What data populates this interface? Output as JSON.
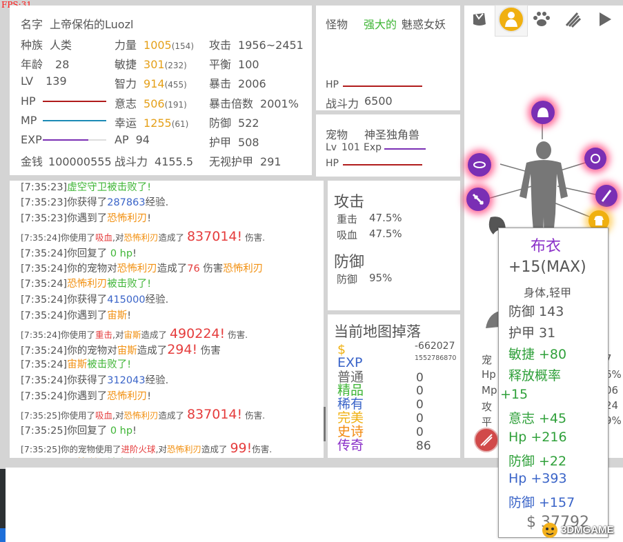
{
  "fps": "FPS:31",
  "player": {
    "stats": [
      {
        "label": "名字",
        "value": "上帝保佑的Luozl"
      },
      {
        "label": "种族",
        "value": "人类"
      },
      {
        "label": "年龄",
        "value": "28"
      },
      {
        "label": "LV",
        "value": "139"
      },
      {
        "label": "HP",
        "value": ""
      },
      {
        "label": "MP",
        "value": ""
      },
      {
        "label": "EXP",
        "value": ""
      },
      {
        "label": "金钱",
        "value": "100000555"
      }
    ],
    "attrs": [
      {
        "label": "力量",
        "value": "1005",
        "bonus": "(154)"
      },
      {
        "label": "敏捷",
        "value": "301",
        "bonus": "(232)"
      },
      {
        "label": "智力",
        "value": "914",
        "bonus": "(455)"
      },
      {
        "label": "意志",
        "value": "506",
        "bonus": "(191)"
      },
      {
        "label": "幸运",
        "value": "1255",
        "bonus": "(61)"
      },
      {
        "label": "AP",
        "value": "94",
        "bonus": ""
      },
      {
        "label": "战斗力",
        "value": "4155.5",
        "bonus": ""
      }
    ],
    "combat": [
      {
        "label": "攻击",
        "value": "1956~2451"
      },
      {
        "label": "平衡",
        "value": "100"
      },
      {
        "label": "暴击",
        "value": "2006"
      },
      {
        "label": "暴击倍数",
        "value": "2001%"
      },
      {
        "label": "防御",
        "value": "522"
      },
      {
        "label": "护甲",
        "value": "508"
      },
      {
        "label": "无视护甲",
        "value": "291"
      }
    ]
  },
  "monster": {
    "label": "怪物",
    "prefix": "强大的",
    "name": "魅惑女妖",
    "hp_label": "HP",
    "power_label": "战斗力",
    "power": "6500",
    "hp_fraction": 1.0
  },
  "pet": {
    "label": "宠物",
    "name": "神圣独角兽",
    "lv_label": "Lv",
    "lv": "101",
    "exp_label": "Exp",
    "hp_label": "HP"
  },
  "log": [
    {
      "t": "[7:35:23]",
      "parts": [
        {
          "c": "c-green",
          "s": "虚空守卫"
        },
        {
          "c": "c-green",
          "s": "被击败了!"
        }
      ],
      "small": false
    },
    {
      "t": "[7:35:23]",
      "parts": [
        {
          "c": "c-gray",
          "s": "你获得了"
        },
        {
          "c": "c-blue",
          "s": "287863"
        },
        {
          "c": "c-gray",
          "s": "经验."
        }
      ],
      "small": false
    },
    {
      "t": "[7:35:23]",
      "parts": [
        {
          "c": "c-gray",
          "s": "你遇到了"
        },
        {
          "c": "c-orange",
          "s": "恐怖利刃"
        },
        {
          "c": "c-gray",
          "s": "!"
        }
      ],
      "small": false
    },
    {
      "t": "[7:35:24]",
      "parts": [
        {
          "c": "c-gray",
          "s": "你使用了"
        },
        {
          "c": "c-red",
          "s": "吸血"
        },
        {
          "c": "c-gray",
          "s": ",对"
        },
        {
          "c": "c-orange",
          "s": "恐怖利刃"
        },
        {
          "c": "c-gray",
          "s": "造成了 "
        },
        {
          "c": "c-red big",
          "s": "837014!"
        },
        {
          "c": "c-gray",
          "s": " 伤害."
        }
      ],
      "small": true
    },
    {
      "t": "[7:35:24]",
      "parts": [
        {
          "c": "c-gray",
          "s": "你回复了 "
        },
        {
          "c": "c-green",
          "s": "0 hp"
        },
        {
          "c": "c-gray",
          "s": "!"
        }
      ],
      "small": false
    },
    {
      "t": "[7:35:24]",
      "parts": [
        {
          "c": "c-gray",
          "s": "你的宠物对"
        },
        {
          "c": "c-orange",
          "s": "恐怖利刃"
        },
        {
          "c": "c-gray",
          "s": "造成了"
        },
        {
          "c": "c-red",
          "s": "76"
        },
        {
          "c": "c-gray",
          "s": " 伤害"
        },
        {
          "c": "c-orange",
          "s": "恐怖利刃"
        }
      ],
      "small": false
    },
    {
      "t": "[7:35:24]",
      "parts": [
        {
          "c": "c-orange",
          "s": "恐怖利刃"
        },
        {
          "c": "c-green",
          "s": "被击败了!"
        }
      ],
      "small": false
    },
    {
      "t": "[7:35:24]",
      "parts": [
        {
          "c": "c-gray",
          "s": "你获得了"
        },
        {
          "c": "c-blue",
          "s": "415000"
        },
        {
          "c": "c-gray",
          "s": "经验."
        }
      ],
      "small": false
    },
    {
      "t": "[7:35:24]",
      "parts": [
        {
          "c": "c-gray",
          "s": "你遇到了"
        },
        {
          "c": "c-orange",
          "s": "宙斯"
        },
        {
          "c": "c-gray",
          "s": "!"
        }
      ],
      "small": false
    },
    {
      "t": "[7:35:24]",
      "parts": [
        {
          "c": "c-gray",
          "s": "你使用了"
        },
        {
          "c": "c-red",
          "s": "重击"
        },
        {
          "c": "c-gray",
          "s": ",对"
        },
        {
          "c": "c-orange",
          "s": "宙斯"
        },
        {
          "c": "c-gray",
          "s": "造成了 "
        },
        {
          "c": "c-red big",
          "s": "490224!"
        },
        {
          "c": "c-gray",
          "s": " 伤害."
        }
      ],
      "small": true
    },
    {
      "t": "[7:35:24]",
      "parts": [
        {
          "c": "c-gray",
          "s": "你的宠物对"
        },
        {
          "c": "c-orange",
          "s": "宙斯"
        },
        {
          "c": "c-gray",
          "s": "造成了"
        },
        {
          "c": "c-red big",
          "s": "294!"
        },
        {
          "c": "c-gray",
          "s": " 伤害"
        }
      ],
      "small": false
    },
    {
      "t": "[7:35:24]",
      "parts": [
        {
          "c": "c-orange",
          "s": "宙斯"
        },
        {
          "c": "c-green",
          "s": "被击败了!"
        }
      ],
      "small": false
    },
    {
      "t": "[7:35:24]",
      "parts": [
        {
          "c": "c-gray",
          "s": "你获得了"
        },
        {
          "c": "c-blue",
          "s": "312043"
        },
        {
          "c": "c-gray",
          "s": "经验."
        }
      ],
      "small": false
    },
    {
      "t": "[7:35:24]",
      "parts": [
        {
          "c": "c-gray",
          "s": "你遇到了"
        },
        {
          "c": "c-orange",
          "s": "恐怖利刃"
        },
        {
          "c": "c-gray",
          "s": "!"
        }
      ],
      "small": false
    },
    {
      "t": "[7:35:25]",
      "parts": [
        {
          "c": "c-gray",
          "s": "你使用了"
        },
        {
          "c": "c-red",
          "s": "吸血"
        },
        {
          "c": "c-gray",
          "s": ",对"
        },
        {
          "c": "c-orange",
          "s": "恐怖利刃"
        },
        {
          "c": "c-gray",
          "s": "造成了 "
        },
        {
          "c": "c-red big",
          "s": "837014!"
        },
        {
          "c": "c-gray",
          "s": " 伤害."
        }
      ],
      "small": true
    },
    {
      "t": "[7:35:25]",
      "parts": [
        {
          "c": "c-gray",
          "s": "你回复了 "
        },
        {
          "c": "c-green",
          "s": "0 hp"
        },
        {
          "c": "c-gray",
          "s": "!"
        }
      ],
      "small": false
    },
    {
      "t": "[7:35:25]",
      "parts": [
        {
          "c": "c-gray",
          "s": "你的宠物使用了"
        },
        {
          "c": "c-red",
          "s": "进阶火球"
        },
        {
          "c": "c-gray",
          "s": ",对"
        },
        {
          "c": "c-orange",
          "s": "恐怖利刃"
        },
        {
          "c": "c-gray",
          "s": "造成了 "
        },
        {
          "c": "c-red big",
          "s": "99!"
        },
        {
          "c": "c-gray",
          "s": "伤害."
        }
      ],
      "small": true
    },
    {
      "t": "[7:35:25]",
      "parts": [
        {
          "c": "c-orange",
          "s": "恐怖利刃"
        },
        {
          "c": "c-green",
          "s": "被击败了!"
        }
      ],
      "small": false
    }
  ],
  "skills": {
    "attack_title": "攻击",
    "attack": [
      {
        "label": "重击",
        "value": "47.5%"
      },
      {
        "label": "吸血",
        "value": "47.5%"
      }
    ],
    "defense_title": "防御",
    "defense": [
      {
        "label": "防御",
        "value": "95%"
      }
    ]
  },
  "drops": {
    "title": "当前地图掉落",
    "money_symbol": "$",
    "money": "-662027",
    "exp_label": "EXP",
    "exp": "1552786870",
    "items": [
      {
        "label": "普通",
        "value": "0",
        "color": "#666666"
      },
      {
        "label": "精品",
        "value": "0",
        "color": "#3fb536"
      },
      {
        "label": "稀有",
        "value": "0",
        "color": "#3a64c8"
      },
      {
        "label": "完美",
        "value": "0",
        "color": "#f0b010"
      },
      {
        "label": "史诗",
        "value": "0",
        "color": "#f28a10"
      },
      {
        "label": "传奇",
        "value": "86",
        "color": "#8a2fc8"
      }
    ]
  },
  "tabs": [
    {
      "name": "bag-icon",
      "active": false
    },
    {
      "name": "character-icon",
      "active": true
    },
    {
      "name": "paw-icon",
      "active": false
    },
    {
      "name": "claw-icon",
      "active": false
    },
    {
      "name": "play-icon",
      "active": false
    }
  ],
  "pet_partial": {
    "labels": [
      "宠",
      "Hp",
      "Mp",
      "攻",
      "平"
    ],
    "values": [
      "7",
      "6%",
      "06",
      "24",
      "9%"
    ]
  },
  "tooltip": {
    "name": "布衣",
    "level": "+15(MAX)",
    "type": "身体,轻甲",
    "base": [
      {
        "label": "防御",
        "value": "143"
      },
      {
        "label": "护甲",
        "value": "31"
      }
    ],
    "bonus_green": [
      {
        "label": "敏捷",
        "value": "+80"
      },
      {
        "label": "释放概率",
        "value": ""
      },
      {
        "label": "",
        "value": "+15"
      },
      {
        "label": "意志",
        "value": "+45"
      },
      {
        "label": "Hp",
        "value": "+216"
      },
      {
        "label": "防御",
        "value": "+22"
      }
    ],
    "bonus_blue": [
      {
        "label": "Hp",
        "value": "+393"
      },
      {
        "label": "防御",
        "value": "+157"
      }
    ],
    "price": "$ 37792"
  },
  "watermark": "3DMGAME"
}
